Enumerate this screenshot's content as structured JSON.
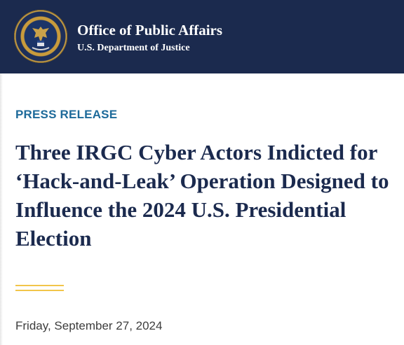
{
  "header": {
    "org_title": "Office of Public Affairs",
    "org_subtitle": "U.S. Department of Justice",
    "seal_icon": "doj-seal-icon",
    "background_color": "#1b2a4e"
  },
  "article": {
    "kicker": "PRESS RELEASE",
    "headline": "Three IRGC Cyber Actors Indicted for ‘Hack-and-Leak’ Operation Designed to Influence the 2024 U.S. Presidential Election",
    "date": "Friday, September 27, 2024"
  },
  "colors": {
    "navy": "#1b2a4e",
    "kicker_blue": "#1d6a9a",
    "accent_gold": "#f2c54a"
  }
}
